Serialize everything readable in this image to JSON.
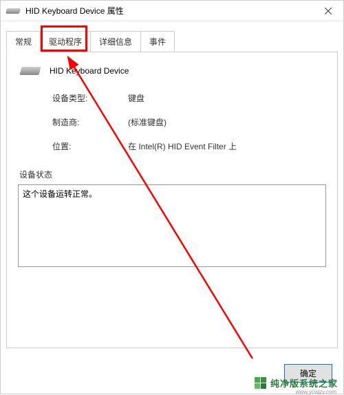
{
  "window": {
    "title": "HID Keyboard Device 属性",
    "close_label": "×"
  },
  "tabs": {
    "general": "常规",
    "driver": "驱动程序",
    "details": "详细信息",
    "events": "事件"
  },
  "device": {
    "name": "HID Keyboard Device"
  },
  "info": {
    "type_label": "设备类型:",
    "type_value": "键盘",
    "manufacturer_label": "制造商:",
    "manufacturer_value": "(标准键盘)",
    "location_label": "位置:",
    "location_value": "在 Intel(R) HID Event Filter 上"
  },
  "status": {
    "label": "设备状态",
    "text": "这个设备运转正常。"
  },
  "buttons": {
    "ok": "确定"
  },
  "watermark": {
    "text": "纯净版系统之家",
    "url": "www.ycwjzy.com"
  }
}
